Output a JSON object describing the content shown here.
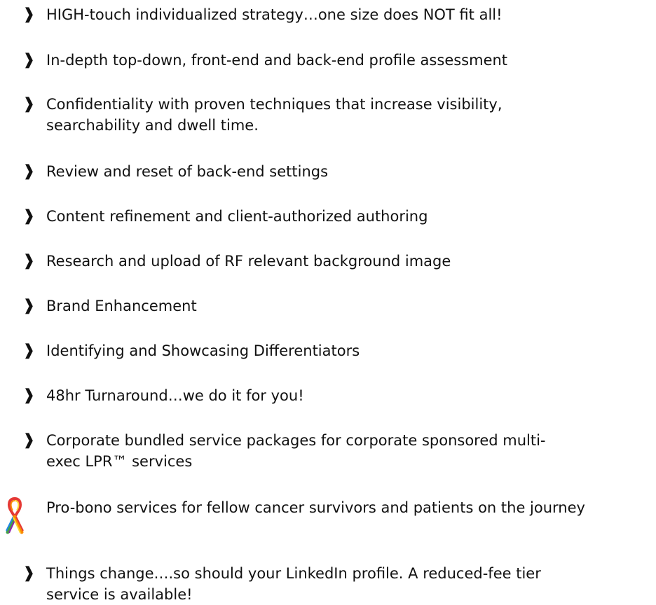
{
  "bullet_glyph": "❱",
  "items": [
    {
      "text": "HIGH-touch individualized strategy…one size does NOT fit all!"
    },
    {
      "text": "In-depth top-down, front-end and back-end profile assessment"
    },
    {
      "text": "Confidentiality with proven techniques that increase visibility, searchability and dwell time."
    },
    {
      "text": "Review and reset of back-end settings"
    },
    {
      "text": "Content refinement and client-authorized authoring"
    },
    {
      "text": "Research and upload of RF relevant background image"
    },
    {
      "text": "Brand Enhancement"
    },
    {
      "text": "Identifying and Showcasing Differentiators"
    },
    {
      "text": "48hr Turnaround…we do it for you!"
    },
    {
      "text": "Corporate bundled service packages for corporate sponsored multi-exec LPR™ services"
    },
    {
      "text": "Pro-bono services for fellow cancer survivors and patients on the journey",
      "icon": "rainbow-awareness-ribbon-icon"
    },
    {
      "text": "Things change….so should your LinkedIn profile. A reduced-fee tier service is available!"
    }
  ]
}
